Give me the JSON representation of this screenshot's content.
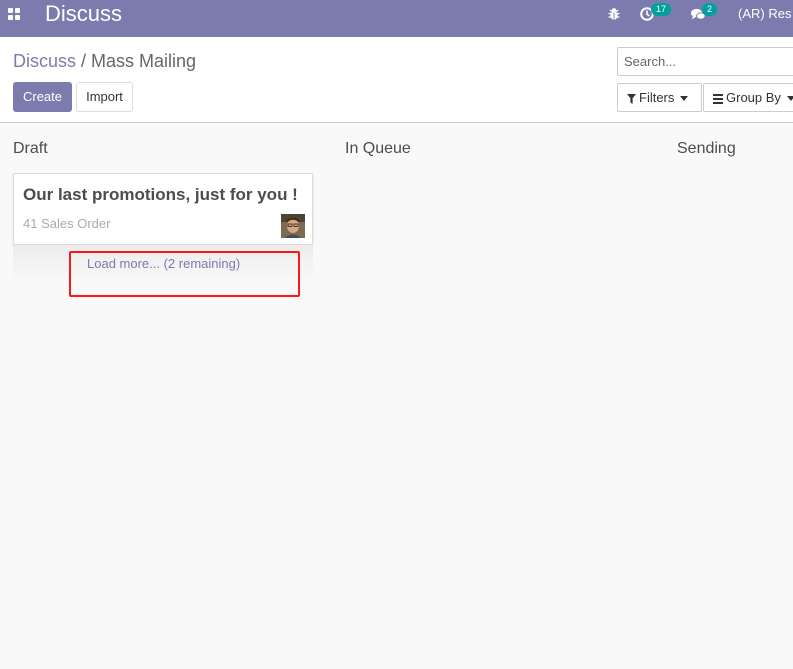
{
  "navbar": {
    "app_name": "Discuss",
    "activity_count": "17",
    "message_count": "2",
    "user": "(AR) Res",
    "icons": [
      "apps-icon",
      "bug-icon",
      "clock-icon",
      "chat-icon"
    ]
  },
  "breadcrumb": {
    "parent": "Discuss",
    "separator": "/",
    "current": "Mass Mailing"
  },
  "buttons": {
    "create": "Create",
    "import": "Import"
  },
  "search": {
    "placeholder": "Search..."
  },
  "search_options": {
    "filters": "Filters",
    "group_by": "Group By"
  },
  "kanban": {
    "columns": [
      {
        "title": "Draft"
      },
      {
        "title": "In Queue"
      },
      {
        "title": "Sending"
      }
    ],
    "cards": [
      {
        "title": "Our last promotions, just for you !",
        "subtitle": "41 Sales Order"
      }
    ],
    "load_more": "Load more... (2 remaining)"
  },
  "colors": {
    "brand": "#7c7bad",
    "badge": "#00a09d",
    "highlight": "#ff1616"
  }
}
